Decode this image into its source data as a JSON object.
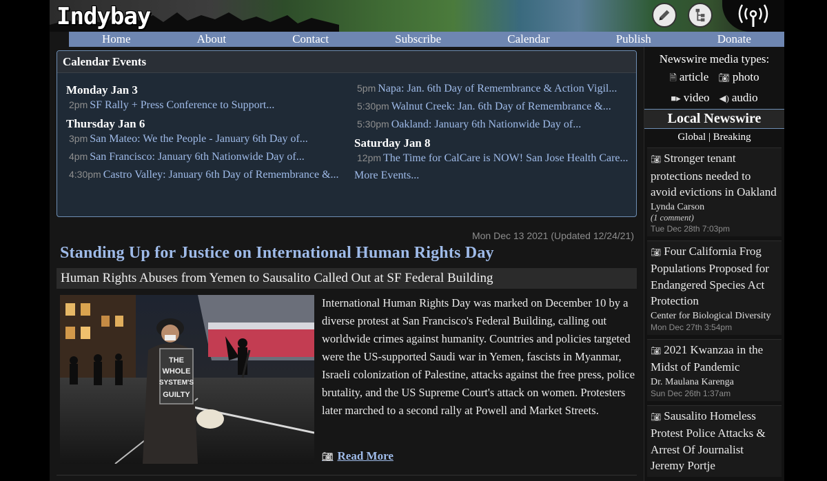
{
  "site": {
    "logo": "Indybay"
  },
  "header": {
    "edit_icon": "pencil-icon",
    "tree_icon": "sitemap-icon",
    "radio_icon": "broadcast-icon"
  },
  "nav": [
    "Home",
    "About",
    "Contact",
    "Subscribe",
    "Calendar",
    "Publish",
    "Donate"
  ],
  "calendar": {
    "title": "Calendar Events",
    "left": [
      {
        "day": "Monday Jan 3",
        "events": [
          {
            "time": "2pm",
            "title": "SF Rally + Press Conference to Support..."
          }
        ]
      },
      {
        "day": "Thursday Jan 6",
        "events": [
          {
            "time": "3pm",
            "title": "San Mateo: We the People - January 6th Day of..."
          },
          {
            "time": "4pm",
            "title": "San Francisco: January 6th Nationwide Day of..."
          },
          {
            "time": "4:30pm",
            "title": "Castro Valley: January 6th Day of Remembrance &..."
          }
        ]
      }
    ],
    "right_events": [
      {
        "time": "5pm",
        "title": "Napa: Jan. 6th Day of Remembrance & Action Vigil..."
      },
      {
        "time": "5:30pm",
        "title": "Walnut Creek: Jan. 6th Day of Remembrance &..."
      },
      {
        "time": "5:30pm",
        "title": "Oakland: January 6th Nationwide Day of..."
      }
    ],
    "right_day": "Saturday Jan 8",
    "right_day_events": [
      {
        "time": "12pm",
        "title": "The Time for CalCare is NOW! San Jose Health Care..."
      }
    ],
    "more": "More Events..."
  },
  "feature": {
    "dateline": "Mon Dec 13 2021 (Updated 12/24/21)",
    "title": "Standing Up for Justice on International Human Rights Day",
    "subhead": "Human Rights Abuses from Yemen to Sausalito Called Out at SF Federal Building",
    "photo_sign": "THE WHOLE SYSTEM'S GUILTY",
    "body": "International Human Rights Day was marked on December 10 by a diverse protest at San Francisco's Federal Building, calling out worldwide crimes against humanity. Countries and policies targeted were the US-supported Saudi war in Yemen, fascists in Myanmar, Israeli colonization of Palestine, attacks against the free press, police brutality, and the US Supreme Court's attack on women. Protesters later marched to a second rally at Powell and Market Streets.",
    "read_more": "Read More"
  },
  "sidebar": {
    "media_types_title": "Newswire media types:",
    "media_types": [
      {
        "icon": "article-icon",
        "label": "article"
      },
      {
        "icon": "photo-icon",
        "label": "photo"
      },
      {
        "icon": "video-icon",
        "label": "video"
      },
      {
        "icon": "audio-icon",
        "label": "audio"
      }
    ],
    "local_title": "Local Newswire",
    "global": "Global",
    "breaking": "Breaking",
    "items": [
      {
        "title": "Stronger tenant protections needed to avoid evictions in Oakland",
        "author": "Lynda Carson",
        "comments": "(1 comment)",
        "date": "Tue Dec 28th 7:03pm"
      },
      {
        "title": "Four California Frog Populations Proposed for Endangered Species Act Protection",
        "author": "Center for Biological Diversity",
        "comments": "",
        "date": "Mon Dec 27th 3:54pm"
      },
      {
        "title": "2021 Kwanzaa in the Midst of Pandemic",
        "author": "Dr. Maulana Karenga",
        "comments": "",
        "date": "Sun Dec 26th 1:37am"
      },
      {
        "title": "Sausalito Homeless Protest Police Attacks & Arrest Of Journalist Jeremy Portje",
        "author": "",
        "comments": "",
        "date": ""
      }
    ]
  }
}
